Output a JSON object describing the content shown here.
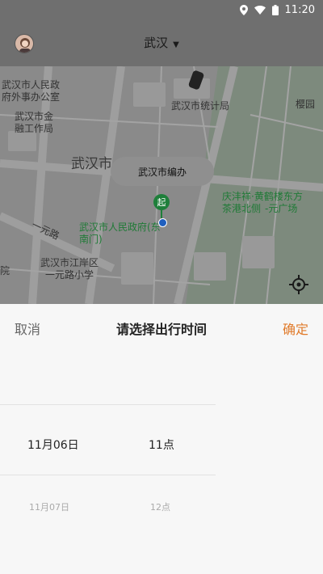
{
  "status": {
    "time": "11:20"
  },
  "header": {
    "city": "武汉"
  },
  "map": {
    "labels": {
      "l1": "武汉市人民政",
      "l2": "府外事办公室",
      "l3": "武汉市金",
      "l4": "融工作局",
      "l5": "武汉市统计局",
      "l6": "樱园",
      "l7": "武汉市",
      "l8": "庆沣祥·黄鹤楼东方",
      "l9": "茶港北侧",
      "l10": "-元广场",
      "l11": "武汉市人民政府(东",
      "l12": "南门)",
      "l13": "一元路",
      "l14": "武汉市江岸区",
      "l15": "一元路小学",
      "l16": "院"
    },
    "bubble": "武汉市编办",
    "pin_char": "起"
  },
  "sheet": {
    "cancel": "取消",
    "title": "请选择出行时间",
    "confirm": "确定",
    "selected": {
      "date": "11月06日",
      "hour": "11点"
    },
    "next": {
      "date": "11月07日",
      "hour": "12点"
    }
  }
}
